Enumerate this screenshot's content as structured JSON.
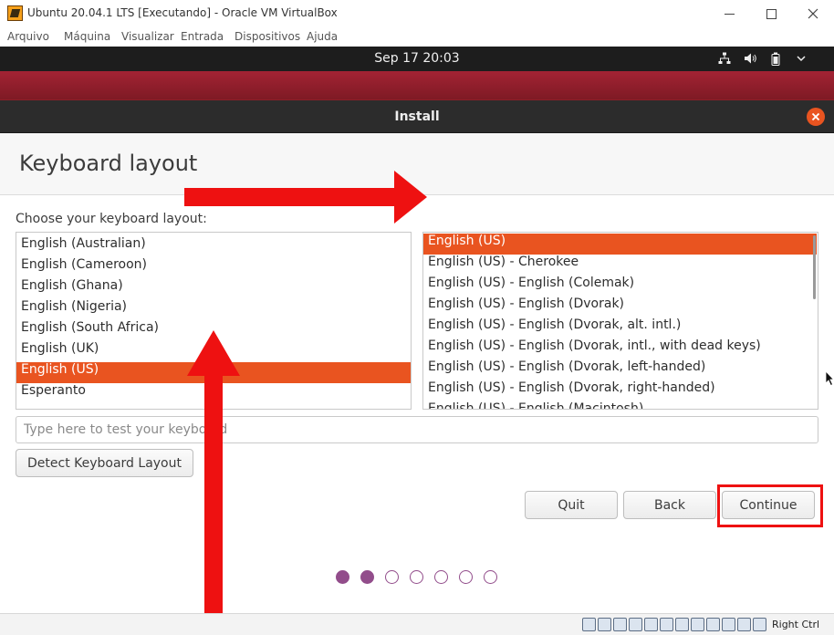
{
  "window": {
    "title": "Ubuntu 20.04.1 LTS [Executando] - Oracle VM VirtualBox",
    "menu": [
      "Arquivo",
      "Máquina",
      "Visualizar",
      "Entrada",
      "Dispositivos",
      "Ajuda"
    ]
  },
  "guest_topbar": {
    "clock": "Sep 17  20:03",
    "tray_icons": [
      "network-icon",
      "volume-icon",
      "battery-icon",
      "chevron-down-icon"
    ]
  },
  "installer": {
    "title": "Install",
    "page_title": "Keyboard layout",
    "choose_label": "Choose your keyboard layout:",
    "layouts": [
      "English (Australian)",
      "English (Cameroon)",
      "English (Ghana)",
      "English (Nigeria)",
      "English (South Africa)",
      "English (UK)",
      "English (US)",
      "Esperanto"
    ],
    "selected_layout": "English (US)",
    "variants": [
      "English (US)",
      "English (US) - Cherokee",
      "English (US) - English (Colemak)",
      "English (US) - English (Dvorak)",
      "English (US) - English (Dvorak, alt. intl.)",
      "English (US) - English (Dvorak, intl., with dead keys)",
      "English (US) - English (Dvorak, left-handed)",
      "English (US) - English (Dvorak, right-handed)",
      "English (US) - English (Macintosh)"
    ],
    "selected_variant": "English (US)",
    "test_placeholder": "Type here to test your keyboard",
    "detect_button": "Detect Keyboard Layout",
    "quit_button": "Quit",
    "back_button": "Back",
    "continue_button": "Continue",
    "progress": {
      "total_steps": 7,
      "completed_steps": 2
    },
    "accent_color": "#e95420"
  },
  "annotations": {
    "arrow_color": "#ee1111",
    "highlight_target": "continue_button"
  },
  "statusbar": {
    "host_key": "Right Ctrl",
    "icons": [
      "hdd-icon",
      "optical-icon",
      "usb-icon",
      "network-icon",
      "shared-folder-icon",
      "display-icon",
      "screen-icon",
      "monitor-icon",
      "video-capture-icon",
      "cpu-icon",
      "mouse-integration-icon",
      "arrow-down-icon"
    ]
  }
}
